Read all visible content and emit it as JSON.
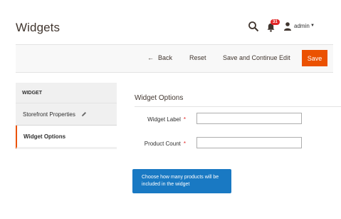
{
  "header": {
    "title": "Widgets",
    "notification_count": "31",
    "user_name": "admin"
  },
  "toolbar": {
    "back_label": "Back",
    "reset_label": "Reset",
    "save_continue_label": "Save and Continue Edit",
    "save_label": "Save"
  },
  "sidebar": {
    "title": "WIDGET",
    "items": [
      {
        "label": "Storefront Properties"
      },
      {
        "label": "Widget Options"
      }
    ]
  },
  "form": {
    "section_title": "Widget Options",
    "fields": [
      {
        "label": "Widget Label",
        "required_mark": "*",
        "value": ""
      },
      {
        "label": "Product Count",
        "required_mark": "*",
        "value": ""
      }
    ]
  },
  "tooltip": {
    "text": "Choose how many products will be included in the widget"
  },
  "colors": {
    "accent": "#eb5202",
    "tooltip_bg": "#1979c3",
    "badge": "#e22626"
  },
  "icons": [
    "search-icon",
    "bell-icon",
    "user-icon",
    "chevron-down-icon",
    "arrow-left-icon",
    "pencil-icon"
  ]
}
